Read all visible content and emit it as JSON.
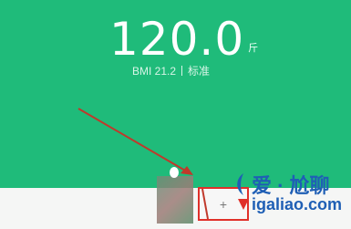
{
  "weight": {
    "value": "120.0",
    "unit": "斤"
  },
  "bmi": {
    "label": "BMI 21.2",
    "status": "标准"
  },
  "watermark": {
    "line1": "爱 · 尬聊",
    "line2": "igaliao.com"
  },
  "colors": {
    "primary": "#1fbb7a",
    "arrow": "#c0392b",
    "highlight": "#e0302a",
    "brand": "#1f5fb5"
  },
  "icons": {
    "add": "plus-icon",
    "avatar": "avatar-icon",
    "brand": "brand-logo-icon",
    "annotation": "arrow-annotation"
  }
}
